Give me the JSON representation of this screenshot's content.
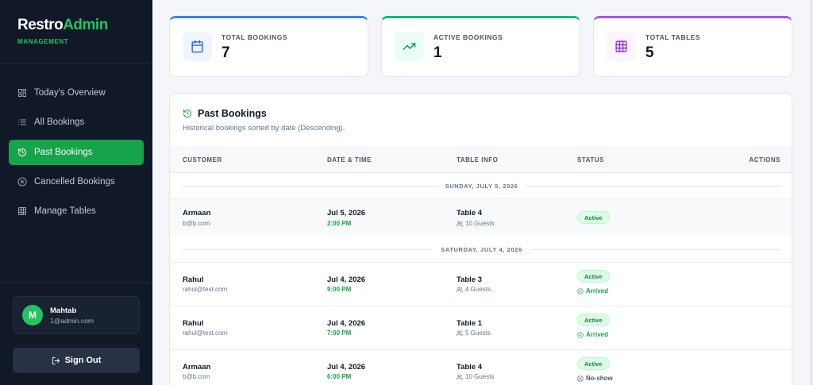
{
  "brand": {
    "name_part1": "Restro",
    "name_part2": "Admin",
    "subtitle": "MANAGEMENT"
  },
  "sidebar": {
    "items": [
      {
        "label": "Today's Overview",
        "icon": "grid-icon"
      },
      {
        "label": "All Bookings",
        "icon": "list-icon"
      },
      {
        "label": "Past Bookings",
        "icon": "history-icon",
        "active": true
      },
      {
        "label": "Cancelled Bookings",
        "icon": "x-circle-icon"
      },
      {
        "label": "Manage Tables",
        "icon": "table-grid-icon"
      }
    ]
  },
  "user": {
    "initial": "M",
    "name": "Mahtab",
    "email": "1@admin.com"
  },
  "signout_label": "Sign Out",
  "stats": [
    {
      "label": "TOTAL BOOKINGS",
      "value": "7",
      "icon": "calendar-icon",
      "color": "#3b82f6"
    },
    {
      "label": "ACTIVE BOOKINGS",
      "value": "1",
      "icon": "trending-up-icon",
      "color": "#10b981"
    },
    {
      "label": "TOTAL TABLES",
      "value": "5",
      "icon": "grid-icon",
      "color": "#a855f7"
    }
  ],
  "panel": {
    "title": "Past Bookings",
    "subtitle": "Historical bookings sorted by date (Descending).",
    "columns": [
      "CUSTOMER",
      "DATE & TIME",
      "TABLE INFO",
      "STATUS",
      "ACTIONS"
    ]
  },
  "groups": [
    {
      "date_label": "SUNDAY, JULY 5, 2026",
      "rows": [
        {
          "customer": "Armaan",
          "email": "b@b.com",
          "date": "Jul 5, 2026",
          "time": "2:00 PM",
          "table": "Table 4",
          "guests": "10 Guests",
          "status": "Active",
          "sub_status": ""
        }
      ]
    },
    {
      "date_label": "SATURDAY, JULY 4, 2026",
      "rows": [
        {
          "customer": "Rahul",
          "email": "rahul@test.com",
          "date": "Jul 4, 2026",
          "time": "9:00 PM",
          "table": "Table 3",
          "guests": "4 Guests",
          "status": "Active",
          "sub_status": "Arrived"
        },
        {
          "customer": "Rahul",
          "email": "rahul@test.com",
          "date": "Jul 4, 2026",
          "time": "7:00 PM",
          "table": "Table 1",
          "guests": "5 Guests",
          "status": "Active",
          "sub_status": "Arrived"
        },
        {
          "customer": "Armaan",
          "email": "b@b.com",
          "date": "Jul 4, 2026",
          "time": "6:00 PM",
          "table": "Table 4",
          "guests": "10 Guests",
          "status": "Active",
          "sub_status": "No-show"
        }
      ]
    }
  ]
}
